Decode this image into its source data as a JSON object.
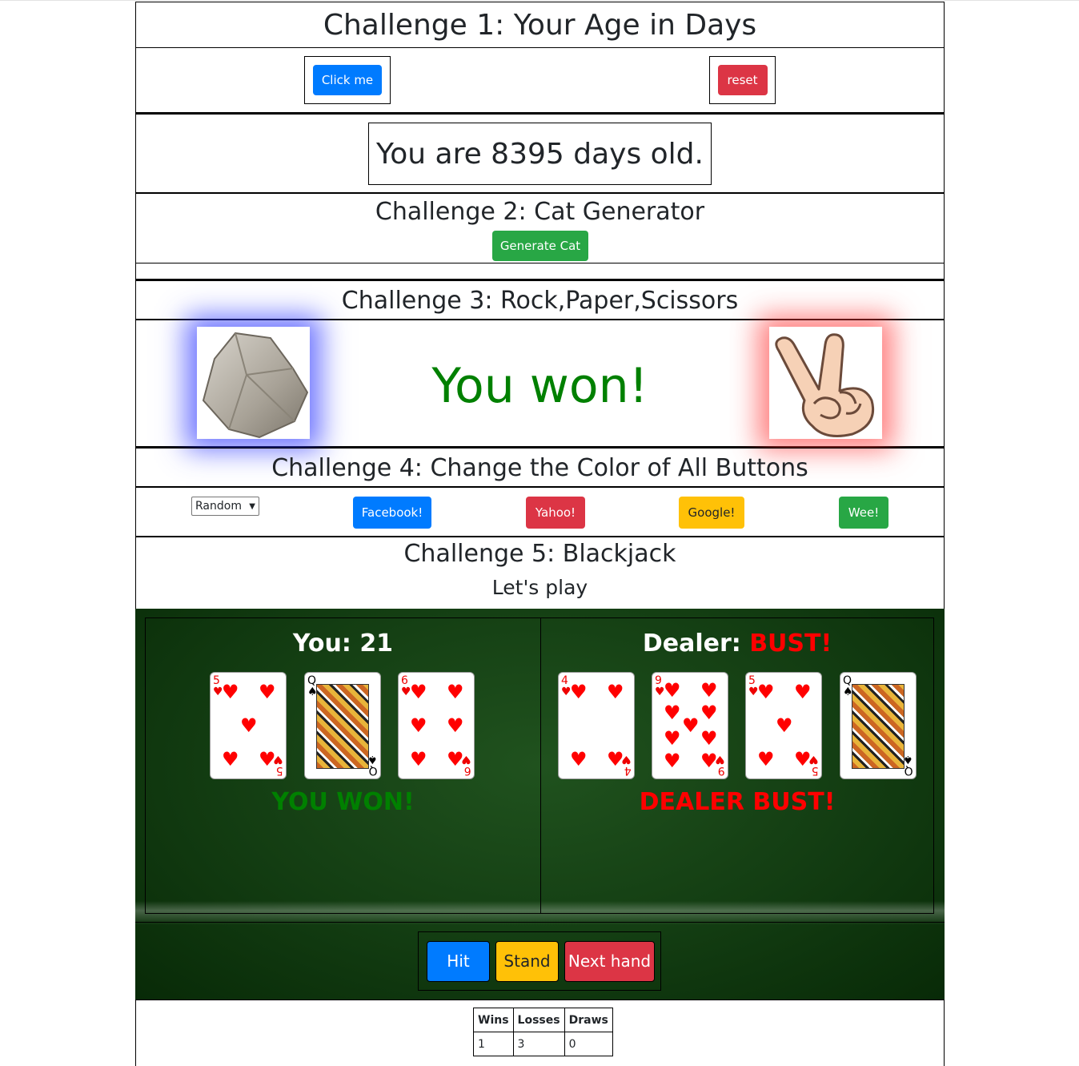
{
  "challenge1": {
    "title": "Challenge 1: Your Age in Days",
    "click_label": "Click me",
    "reset_label": "reset",
    "result": "You are 8395 days old."
  },
  "challenge2": {
    "title": "Challenge 2: Cat Generator",
    "button_label": "Generate Cat"
  },
  "challenge3": {
    "title": "Challenge 3: Rock,Paper,Scissors",
    "human_choice": "rock",
    "bot_choice": "scissors",
    "message": "You won!",
    "message_color": "#008000"
  },
  "challenge4": {
    "title": "Challenge 4: Change the Color of All Buttons",
    "select_value": "Random",
    "buttons": [
      "Facebook!",
      "Yahoo!",
      "Google!",
      "Wee!"
    ]
  },
  "challenge5": {
    "title": "Challenge 5: Blackjack",
    "subtitle": "Let's play",
    "you": {
      "label": "You: ",
      "score": "21",
      "cards": [
        "5",
        "Q",
        "6"
      ],
      "result": "YOU WON!",
      "result_color": "#008000"
    },
    "dealer": {
      "label": "Dealer: ",
      "score": "BUST!",
      "cards": [
        "4",
        "9",
        "5",
        "Q"
      ],
      "result": "DEALER BUST!",
      "result_color": "#ff0000"
    },
    "hit_label": "Hit",
    "stand_label": "Stand",
    "next_label": "Next hand",
    "table": {
      "headers": [
        "Wins",
        "Losses",
        "Draws"
      ],
      "values": [
        "1",
        "3",
        "0"
      ]
    }
  },
  "colors": {
    "primary": "#007bff",
    "danger": "#dc3545",
    "success": "#28a745",
    "warning": "#ffc107",
    "felt": "#133d12"
  }
}
